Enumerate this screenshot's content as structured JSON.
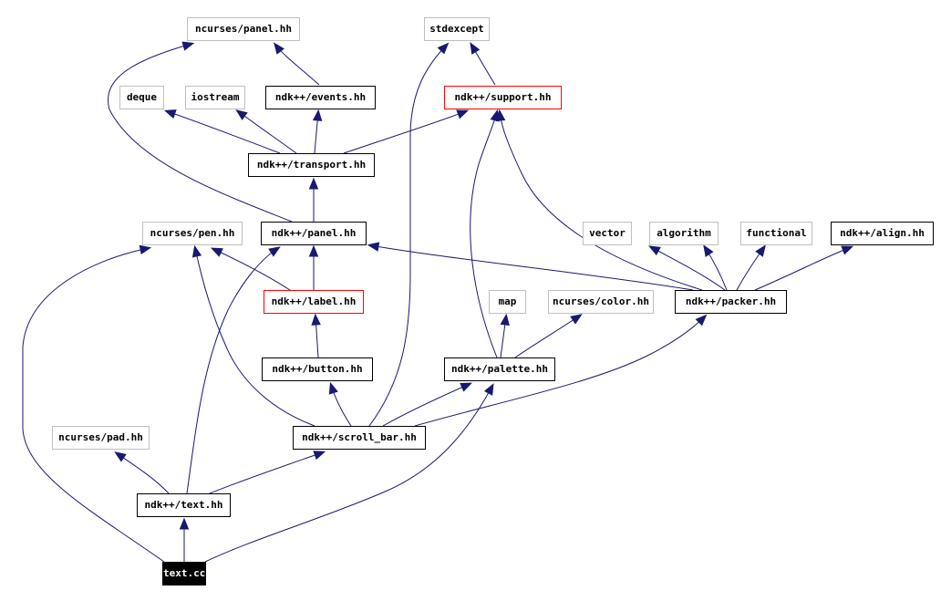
{
  "colors": {
    "edge": "#191970",
    "external_border": "#bfbfbf",
    "internal_border": "#000000",
    "highlight_border": "#ff0000",
    "root_fill": "#000000"
  },
  "nodes": {
    "ncurses_panel": {
      "label": "ncurses/panel.hh",
      "kind": "ext"
    },
    "stdexcept": {
      "label": "stdexcept",
      "kind": "ext"
    },
    "deque": {
      "label": "deque",
      "kind": "ext"
    },
    "iostream": {
      "label": "iostream",
      "kind": "ext"
    },
    "events": {
      "label": "ndk++/events.hh",
      "kind": "int"
    },
    "support": {
      "label": "ndk++/support.hh",
      "kind": "red"
    },
    "transport": {
      "label": "ndk++/transport.hh",
      "kind": "int"
    },
    "pen": {
      "label": "ncurses/pen.hh",
      "kind": "ext"
    },
    "panel": {
      "label": "ndk++/panel.hh",
      "kind": "int"
    },
    "vector": {
      "label": "vector",
      "kind": "ext"
    },
    "algorithm": {
      "label": "algorithm",
      "kind": "ext"
    },
    "functional": {
      "label": "functional",
      "kind": "ext"
    },
    "align": {
      "label": "ndk++/align.hh",
      "kind": "int"
    },
    "label": {
      "label": "ndk++/label.hh",
      "kind": "red"
    },
    "map": {
      "label": "map",
      "kind": "ext"
    },
    "color": {
      "label": "ncurses/color.hh",
      "kind": "ext"
    },
    "packer": {
      "label": "ndk++/packer.hh",
      "kind": "int"
    },
    "button": {
      "label": "ndk++/button.hh",
      "kind": "int"
    },
    "palette": {
      "label": "ndk++/palette.hh",
      "kind": "int"
    },
    "pad": {
      "label": "ncurses/pad.hh",
      "kind": "ext"
    },
    "scroll_bar": {
      "label": "ndk++/scroll_bar.hh",
      "kind": "int"
    },
    "text": {
      "label": "ndk++/text.hh",
      "kind": "int"
    },
    "text_cc": {
      "label": "text.cc",
      "kind": "root"
    }
  },
  "edges": [
    [
      "events",
      "ncurses_panel"
    ],
    [
      "support",
      "stdexcept"
    ],
    [
      "transport",
      "deque"
    ],
    [
      "transport",
      "iostream"
    ],
    [
      "transport",
      "events"
    ],
    [
      "transport",
      "support"
    ],
    [
      "panel",
      "transport"
    ],
    [
      "panel",
      "ncurses_panel"
    ],
    [
      "label",
      "pen"
    ],
    [
      "label",
      "panel"
    ],
    [
      "packer",
      "panel"
    ],
    [
      "packer",
      "support"
    ],
    [
      "packer",
      "vector"
    ],
    [
      "packer",
      "algorithm"
    ],
    [
      "packer",
      "functional"
    ],
    [
      "packer",
      "align"
    ],
    [
      "button",
      "label"
    ],
    [
      "palette",
      "support"
    ],
    [
      "palette",
      "map"
    ],
    [
      "palette",
      "color"
    ],
    [
      "scroll_bar",
      "pen"
    ],
    [
      "scroll_bar",
      "button"
    ],
    [
      "scroll_bar",
      "palette"
    ],
    [
      "scroll_bar",
      "packer"
    ],
    [
      "scroll_bar",
      "stdexcept"
    ],
    [
      "text",
      "pad"
    ],
    [
      "text",
      "scroll_bar"
    ],
    [
      "text",
      "panel"
    ],
    [
      "text_cc",
      "text"
    ],
    [
      "text_cc",
      "pen"
    ],
    [
      "text_cc",
      "palette"
    ]
  ]
}
